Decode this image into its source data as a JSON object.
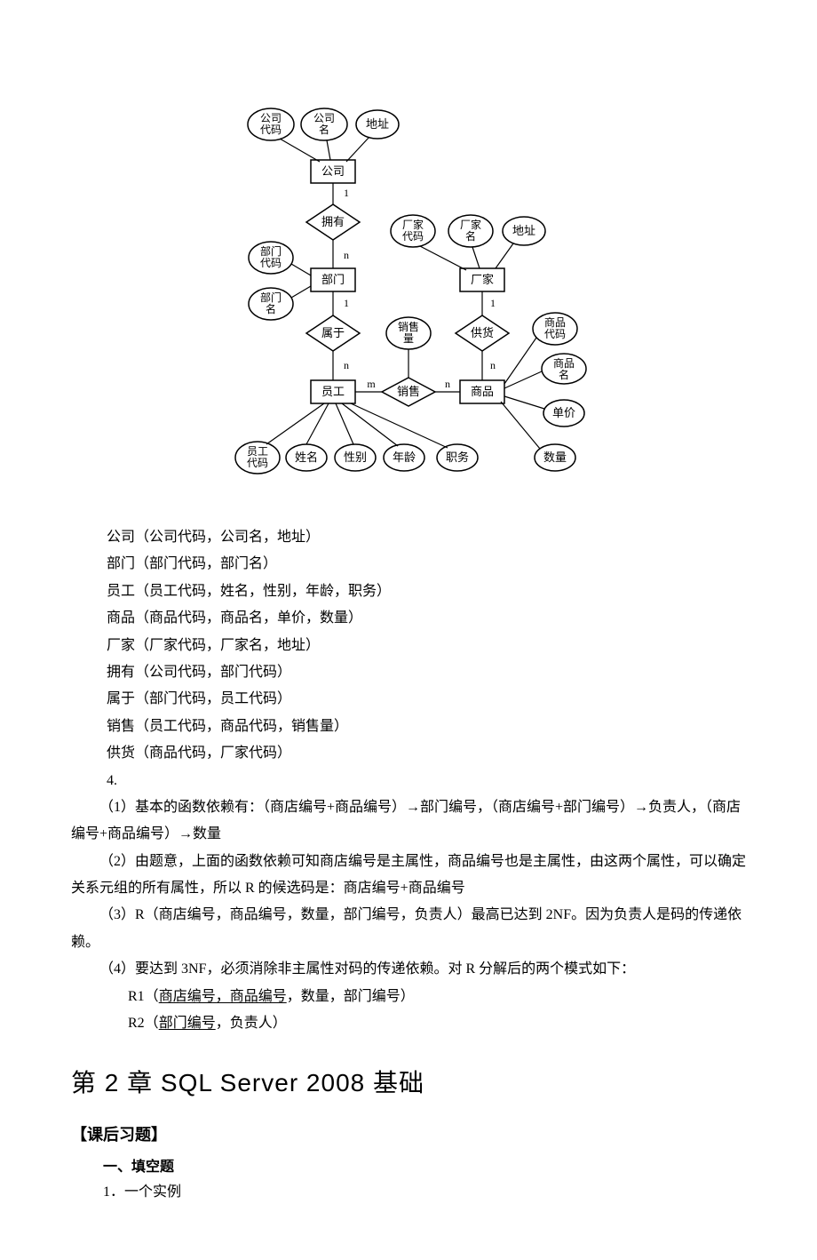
{
  "diagram": {
    "entities": {
      "company": "公司",
      "department": "部门",
      "employee": "员工",
      "product": "商品",
      "factory": "厂家"
    },
    "relationships": {
      "has": "拥有",
      "belongs": "属于",
      "sells": "销售",
      "supplies": "供货"
    },
    "attributes": {
      "company_code": "公司代码",
      "company_name": "公司名",
      "company_addr": "地址",
      "dept_code": "部门代码",
      "dept_name": "部门名",
      "factory_code": "厂家代码",
      "factory_name": "厂家名",
      "factory_addr": "地址",
      "product_code": "商品代码",
      "product_name": "商品名",
      "unit_price": "单价",
      "quantity": "数量",
      "sales_volume": "销售量",
      "emp_code": "员工代码",
      "emp_name": "姓名",
      "emp_gender": "性别",
      "emp_age": "年龄",
      "emp_title": "职务"
    },
    "cardinality": {
      "one": "1",
      "many_n": "n",
      "many_m": "m"
    }
  },
  "relations": {
    "company": "公司（公司代码，公司名，地址）",
    "department": "部门（部门代码，部门名）",
    "employee": "员工（员工代码，姓名，性别，年龄，职务）",
    "product": "商品（商品代码，商品名，单价，数量）",
    "factory": "厂家（厂家代码，厂家名，地址）",
    "has": "拥有（公司代码，部门代码）",
    "belongs": "属于（部门代码，员工代码）",
    "sells": "销售（员工代码，商品代码，销售量）",
    "supplies": "供货（商品代码，厂家代码）",
    "q4_label": "4."
  },
  "answers": {
    "p1": "（1）基本的函数依赖有：（商店编号+商品编号）→部门编号，（商店编号+部门编号）→负责人，（商店编号+商品编号）→数量",
    "p2": "（2）由题意，上面的函数依赖可知商店编号是主属性，商品编号也是主属性，由这两个属性，可以确定关系元组的所有属性，所以 R 的候选码是：商店编号+商品编号",
    "p3": "（3）R（商店编号，商品编号，数量，部门编号，负责人）最高已达到 2NF。因为负责人是码的传递依赖。",
    "p4": "（4）要达到 3NF，必须消除非主属性对码的传递依赖。对 R 分解后的两个模式如下：",
    "r1_prefix": "R1（",
    "r1_key": "商店编号，商品编号",
    "r1_suffix": "，数量，部门编号）",
    "r2_prefix": "R2（",
    "r2_key": "部门编号",
    "r2_suffix": "，负责人）"
  },
  "chapter": {
    "title": "第 2 章   SQL Server 2008 基础",
    "section": "【课后习题】",
    "fill_heading": "一、填空题",
    "q1": "1．一个实例"
  }
}
